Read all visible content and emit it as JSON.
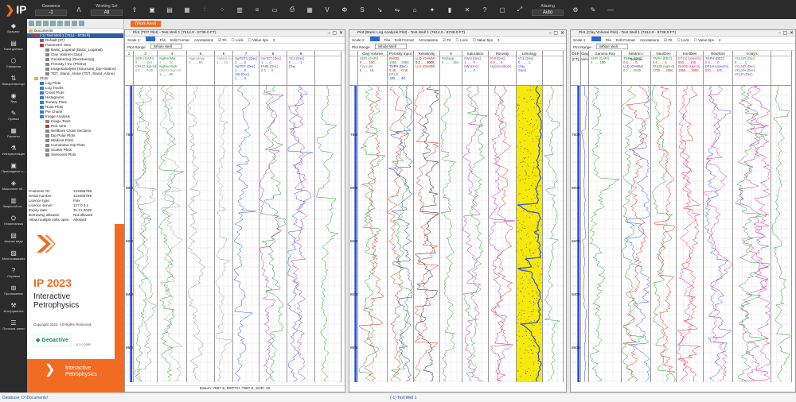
{
  "app": {
    "logo": "IP"
  },
  "toolbar": {
    "well_label": "Скважина",
    "well_value": "-1",
    "working_set_label": "Working Set",
    "working_set_value": "All",
    "aliasing_label": "Aliasing",
    "aliasing_value": "Auto"
  },
  "sidebar": {
    "items": [
      {
        "label": "Браузер",
        "icon": "browser-icon"
      },
      {
        "label": "База данных",
        "icon": "database-icon"
      },
      {
        "label": "Скважина",
        "icon": "well-icon"
      },
      {
        "label": "Импорт/экспорт",
        "icon": "import-icon"
      },
      {
        "label": "Вид",
        "icon": "view-icon"
      },
      {
        "label": "Правка",
        "icon": "edit-icon"
      },
      {
        "label": "Расчеты",
        "icon": "calc-icon"
      },
      {
        "label": "Интерпретация",
        "icon": "interp-icon"
      },
      {
        "label": "Прикладные п...",
        "icon": "apps-icon"
      },
      {
        "label": "Машинное об...",
        "icon": "ml-icon"
      },
      {
        "label": "Закрытый сп...",
        "icon": "closed-icon"
      },
      {
        "label": "Геомеханика",
        "icon": "geomech-icon"
      },
      {
        "label": "Анализ вида",
        "icon": "analysis-icon"
      },
      {
        "label": "Многоскважина",
        "icon": "multiwell-icon"
      },
      {
        "label": "Справка",
        "icon": "help-icon"
      },
      {
        "label": "Приложения",
        "icon": "plugins-icon"
      },
      {
        "label": "Инструменты",
        "icon": "tools-icon"
      },
      {
        "label": "Пользов. мени",
        "icon": "user-menu-icon"
      }
    ]
  },
  "tree": {
    "rows": [
      {
        "label": "Documents",
        "indent": 0,
        "color": "#e8b040"
      },
      {
        "label": "(-1) Test Well 1  [7614 - 8738 ft]",
        "indent": 1,
        "color": "#c0392b",
        "selected": true
      },
      {
        "label": "Default (37)",
        "indent": 2,
        "color": "#3a7bd5"
      },
      {
        "label": "Parameter Sets",
        "indent": 2,
        "color": "#c0392b"
      },
      {
        "label": "Basic_Loganal (Basic_Loganal)",
        "indent": 3,
        "color": "#888"
      },
      {
        "label": "Clay Volume (Clay)",
        "indent": 3,
        "color": "#888"
      },
      {
        "label": "Geosteering (Geosteering)",
        "indent": 3,
        "color": "#888"
      },
      {
        "label": "Porosity / Sw (PhiSw)",
        "indent": 3,
        "color": "#888"
      },
      {
        "label": "Imagesanalysis (Structural_Dip-rotation)",
        "indent": 3,
        "color": "#888"
      },
      {
        "label": "TDT_Stand_Alone (TDT_Stand_Alone)",
        "indent": 3,
        "color": "#888"
      },
      {
        "label": "Plots",
        "indent": 1,
        "color": "#e8b040"
      },
      {
        "label": "Log Plots",
        "indent": 2,
        "color": "#3a7bd5"
      },
      {
        "label": "Log Tracks",
        "indent": 2,
        "color": "#3a7bd5"
      },
      {
        "label": "Cross Plots",
        "indent": 2,
        "color": "#3a7bd5"
      },
      {
        "label": "Histograms",
        "indent": 2,
        "color": "#3a7bd5"
      },
      {
        "label": "Ternary Plots",
        "indent": 2,
        "color": "#3a7bd5"
      },
      {
        "label": "Rose Plots",
        "indent": 2,
        "color": "#3a7bd5"
      },
      {
        "label": "Pie Charts",
        "indent": 2,
        "color": "#3a7bd5"
      },
      {
        "label": "Image Analysis",
        "indent": 2,
        "color": "#3a7bd5"
      },
      {
        "label": "Image Tools",
        "indent": 3,
        "color": "#888"
      },
      {
        "label": "Pick Sets",
        "indent": 3,
        "color": "#c0392b"
      },
      {
        "label": "Wellbore Cross Sections",
        "indent": 3,
        "color": "#888"
      },
      {
        "label": "Dip Polar Plots",
        "indent": 3,
        "color": "#888"
      },
      {
        "label": "Walkout Plots",
        "indent": 3,
        "color": "#888"
      },
      {
        "label": "Cumulative Dip Plots",
        "indent": 3,
        "color": "#888"
      },
      {
        "label": "Scatter Plots",
        "indent": 3,
        "color": "#888"
      },
      {
        "label": "Stereonet Plots",
        "indent": 3,
        "color": "#888"
      }
    ]
  },
  "license": {
    "rows": [
      {
        "k": "Customer ID:",
        "v": "123456789"
      },
      {
        "k": "Serial number:",
        "v": "123456789"
      },
      {
        "k": "Licence type:",
        "v": "Flex"
      },
      {
        "k": "Licence server:",
        "v": "127.0.0.1"
      },
      {
        "k": "Expiry date:",
        "v": "31.12.2049"
      },
      {
        "k": "Borrowing allowed:",
        "v": "Not allowed"
      },
      {
        "k": "Allow multiple volts open:",
        "v": "Allowed"
      }
    ]
  },
  "splash": {
    "title": "IP 2023",
    "subtitle1": "Interactive",
    "subtitle2": "Petrophysics",
    "copyright": "Copyright 2023. All Rights Reserved.",
    "geo": "Geoactive",
    "version": "5.3.0.2580",
    "foot1": "Interactive",
    "foot2": "Petrophysics"
  },
  "workarea": {
    "tab": "[Work Area]"
  },
  "plot1": {
    "title": "Plot (TDT Plot) - Test Well 1 (7614.0 - 8738.0 FT)",
    "scale_label": "Scale 1:",
    "file": "File",
    "edit_format": "Edit Format",
    "annotations": "Annotations",
    "fit": "Fit",
    "lock": "Lock",
    "value_tips": "Value tips",
    "tips_num": "2",
    "plot_range_label": "Plot Range",
    "plot_range": "Whole Well",
    "status": "Datum: 7887.5,  DEPTH: 7887.5,  SGR: 22",
    "tracks": [
      {
        "num": "1",
        "curves": []
      },
      {
        "num": "3",
        "curves": [
          "SGR (GAPI)",
          "0 ........ 150.",
          "CRHO (kg/m3)",
          "0.5 ..... 0.05"
        ]
      },
      {
        "num": "4",
        "curves": [
          "SigRecMat",
          "1. ...... 50.",
          "SigRecHydr",
          "DRHO (kg/m3)",
          "1. ...... 50."
        ]
      },
      {
        "num": "5",
        "curves": [
          "SigmatApp",
          "0. ...... 50."
        ]
      },
      {
        "num": "6",
        "curves": [
          "SigMat (cu)",
          "1. ... 50."
        ]
      },
      {
        "num": "7",
        "curves": [
          "SwTDTU (Dec)",
          "1. ..... 0.",
          "SwTDT (Dec)",
          "1. ..... 0.",
          "SW (Dec)",
          "1. ..... 0."
        ]
      },
      {
        "num": "8",
        "curves": [
          "SwTDT (Dec)",
          "1. .... 0.",
          "PHIE (Dec)",
          "0.5 .... 0."
        ]
      },
      {
        "num": "9",
        "curves": [
          "VCL (Dec)",
          "0 ........ 1.",
          "Clay"
        ]
      },
      {
        "num": "",
        "curves": []
      }
    ],
    "depths": [
      "7800",
      "8000",
      "8200",
      "8400",
      "8600"
    ]
  },
  "plot2": {
    "title": "Plot (Basic Log Analysis Plot) - Test Well 1 (7614.0 - 8738.0 FT)",
    "scale_label": "Scale 1:",
    "file": "File",
    "edit_format": "Edit Format",
    "annotations": "Annotations",
    "fit": "Fit",
    "lock": "Lock",
    "value_tips": "Value tips",
    "tips_num": "2",
    "plot_range_label": "Plot Range",
    "plot_range": "Whole Well",
    "tracks": [
      {
        "num": "",
        "curves": []
      },
      {
        "num": "Clay Volume",
        "curves": [
          "SGR (GAPI)",
          "0 ...... 150.",
          "CALI (in)",
          "6 ....... 16."
        ]
      },
      {
        "num": "Porosity Input",
        "curves": [
          "RHOB",
          "1950. .. 2950.",
          "TNPH (Dec)",
          "0.45 ... -0.15",
          "DTLN",
          "140. .... 40."
        ]
      },
      {
        "num": "Resistivity",
        "curves": [
          "LLD (OHMM)",
          "0.2 ..... 2000.",
          "LLS (OHMM)"
        ]
      },
      {
        "num": "6",
        "curves": [
          "RShapp",
          "0 ........ 150."
        ]
      },
      {
        "num": "Saturation",
        "curves": [
          "SWU (Dec)",
          "1. ..... 0.",
          "SW (Dec)",
          "1. ..... 0."
        ]
      },
      {
        "num": "Porosity",
        "curves": [
          "PHI (Dec)",
          "0.5 .... 0.",
          "Hydrocarbons"
        ]
      },
      {
        "num": "Lithology",
        "curves": [
          "VCL (Dec)",
          "0 ....... 1.",
          "Clay",
          "Sand"
        ]
      },
      {
        "num": "",
        "curves": []
      }
    ],
    "depths": [
      "7800",
      "8000",
      "8200",
      "8400",
      "8600"
    ]
  },
  "plot3": {
    "title": "Plot (Clay Volume Plot) - Test Well 1 (7614.0 - 8738.0 FT)",
    "scale_label": "Scale 1:",
    "file": "File",
    "edit_format": "Edit Format",
    "annotations": "Annotations",
    "fit": "Fit",
    "lock": "Lock",
    "value_tips": "Value tips",
    "tips_num": "2",
    "plot_range_label": "Plot Range",
    "plot_range": "Whole Well",
    "tracks": [
      {
        "num": "DEP (FT)",
        "curves": []
      },
      {
        "num": "Clay Volume",
        "curves": []
      },
      {
        "num": "Gamma Ray",
        "curves": [
          "SGR (GAPI)",
          "0 ...... 150."
        ]
      },
      {
        "num": "Neutron / Resistiv",
        "curves": [
          "TNPH (DEC)",
          "0.6 ...... 0.",
          "LLD (OHMM)",
          "0.2 .... 2000."
        ]
      },
      {
        "num": "Neu/Den",
        "curves": [
          "TNPH (DEC)",
          "0.6 ...... 0.",
          "RHOB (kg/m3)",
          "1700. ... 2950."
        ]
      },
      {
        "num": "Son/Den",
        "curves": [
          "DTLN (uSec/m)",
          "500. .... 100.",
          "RHOB (kg/m3)",
          "1950. ... 2950."
        ]
      },
      {
        "num": "Neu/Son",
        "curves": [
          "TNPH (DEC)",
          "0.6 ...... 0.",
          "DTLN (uSec/m)",
          "500. ... 100."
        ]
      },
      {
        "num": "Vclay's",
        "curves": [
          "VCLGR (Dec)",
          "0 ....... 1.",
          "VCLND (Dec)",
          "VCLSN (Dec)",
          "VCLR (Dec)"
        ]
      },
      {
        "num": "",
        "curves": []
      }
    ],
    "depths": [
      "7800",
      "8000",
      "8200",
      "8400",
      "8600"
    ]
  },
  "status": {
    "database": "Database: D:\\Documents\\",
    "well": "(-1) Test Well 1"
  },
  "colors": {
    "accent": "#f26b22",
    "toolbar_bg": "#2b2b2b",
    "selection": "#2b5ea7"
  }
}
